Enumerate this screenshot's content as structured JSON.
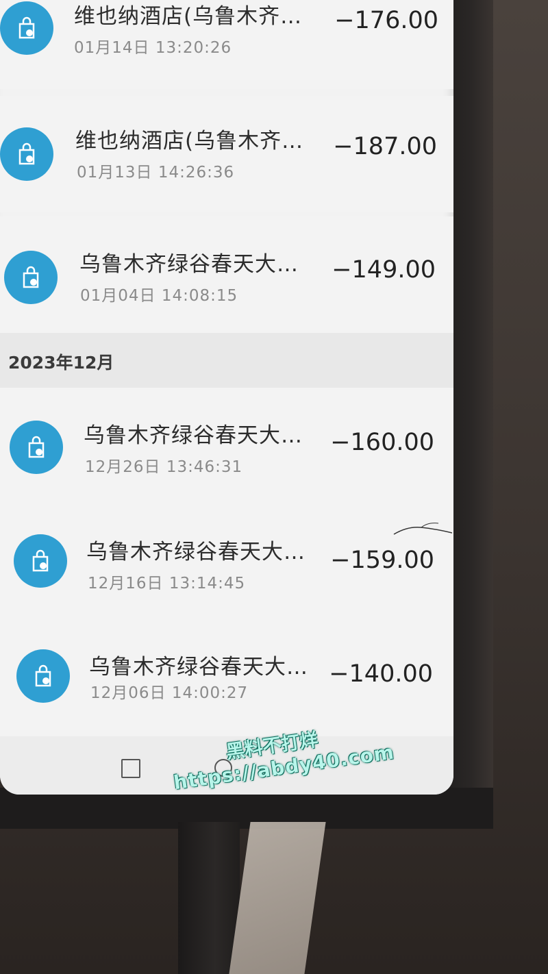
{
  "transactions_top": [
    {
      "merchant": "维也纳酒店(乌鲁木齐…",
      "time": "01月14日 13:20:26",
      "amount": "−176.00"
    },
    {
      "merchant": "维也纳酒店(乌鲁木齐…",
      "time": "01月13日 14:26:36",
      "amount": "−187.00"
    },
    {
      "merchant": "乌鲁木齐绿谷春天大…",
      "time": "01月04日 14:08:15",
      "amount": "−149.00"
    }
  ],
  "month_header": "2023年12月",
  "transactions_bottom": [
    {
      "merchant": "乌鲁木齐绿谷春天大…",
      "time": "12月26日 13:46:31",
      "amount": "−160.00"
    },
    {
      "merchant": "乌鲁木齐绿谷春天大…",
      "time": "12月16日 13:14:45",
      "amount": "−159.00"
    },
    {
      "merchant": "乌鲁木齐绿谷春天大…",
      "time": "12月06日 14:00:27",
      "amount": "−140.00"
    }
  ],
  "icon": "shopping-bag-icon",
  "colors": {
    "icon_bg": "#2f9fd2",
    "watermark": "#b8f5ea"
  },
  "watermark": {
    "line1": "黑料不打烊",
    "line2": "https://abdy40.com"
  }
}
